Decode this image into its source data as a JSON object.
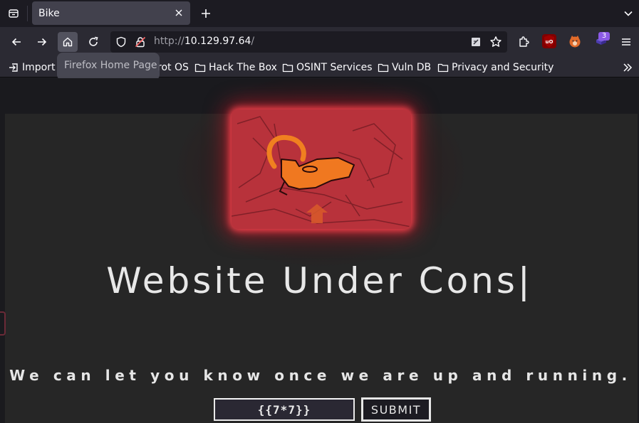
{
  "tabbar": {
    "tab_title": "Bike"
  },
  "navbar": {
    "url_scheme": "http://",
    "url_host": "10.129.97.64",
    "url_path": "/",
    "extension_badge": "3",
    "icons": [
      "back-icon",
      "forward-icon",
      "home-icon",
      "reload-icon",
      "shield-icon",
      "insecure-lock-icon",
      "reader-view-icon",
      "bookmark-star-icon",
      "extensions-icon",
      "ublock-icon",
      "foxyproxy-icon",
      "extension-badge-icon",
      "menu-icon"
    ]
  },
  "bookmarks": {
    "import_label": "Import",
    "partial_label": "rot OS",
    "items": [
      "Hack The Box",
      "OSINT Services",
      "Vuln DB",
      "Privacy and Security"
    ]
  },
  "tooltip": {
    "text": "Firefox Home Page"
  },
  "page": {
    "headline": "Website Under Cons",
    "cursor": "|",
    "subline": "We can let you know once we are up and running.",
    "email_value": "{{7*7}}",
    "submit_label": "SUBMIT"
  },
  "colors": {
    "browser_bg": "#1c1b22",
    "toolbar_bg": "#2b2a33",
    "page_bg": "#262626",
    "hero_red": "#b8323b",
    "glow": "#ff4650"
  }
}
